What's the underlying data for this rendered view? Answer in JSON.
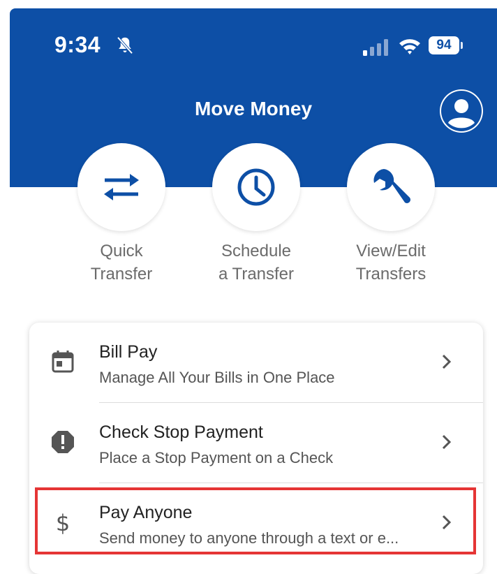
{
  "status_bar": {
    "time": "9:34",
    "battery": "94"
  },
  "header": {
    "title": "Move Money",
    "background_color": "#0d4fa6"
  },
  "quick_actions": [
    {
      "label": "Quick\nTransfer",
      "icon": "transfer-arrows-icon"
    },
    {
      "label": "Schedule\na Transfer",
      "icon": "clock-icon"
    },
    {
      "label": "View/Edit\nTransfers",
      "icon": "wrench-icon"
    }
  ],
  "menu": [
    {
      "title": "Bill Pay",
      "subtitle": "Manage All Your Bills in One Place",
      "icon": "calendar-icon"
    },
    {
      "title": "Check Stop Payment",
      "subtitle": "Place a Stop Payment on a Check",
      "icon": "alert-octagon-icon"
    },
    {
      "title": "Pay Anyone",
      "subtitle": "Send money to anyone through a text or e...",
      "icon": "dollar-icon"
    }
  ],
  "highlight_color": "#e53535"
}
